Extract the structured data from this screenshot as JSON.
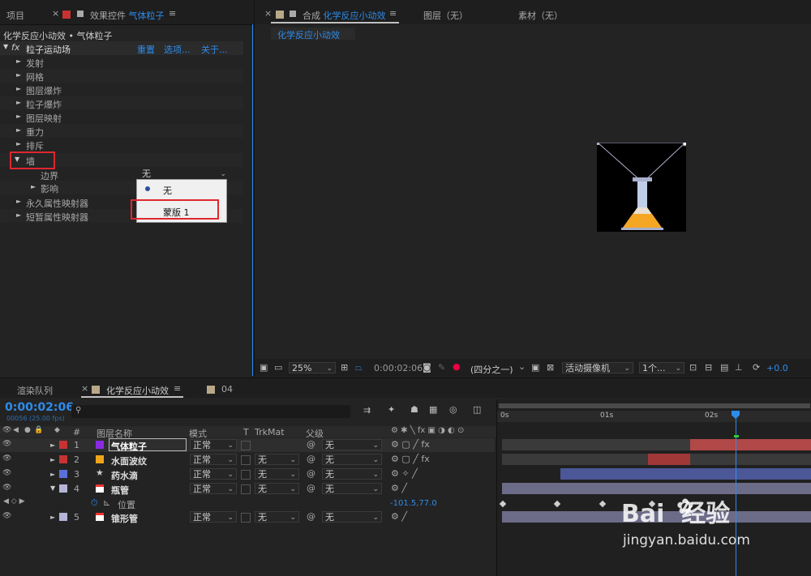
{
  "left_panel": {
    "tab_project": "项目",
    "tab_effects": "效果控件",
    "tab_effects_layer": "气体粒子",
    "breadcrumb": "化学反应小动效 • 气体粒子",
    "effect_name": "粒子运动场",
    "effect_reset": "重置",
    "effect_options": "选项...",
    "effect_about": "关于...",
    "props": [
      "发射",
      "网格",
      "图层爆炸",
      "粒子爆炸",
      "图层映射",
      "重力",
      "排斥"
    ],
    "wall_label": "墙",
    "boundary_label": "边界",
    "boundary_value": "无",
    "affect_label": "影响",
    "persistent_label": "永久属性映射器",
    "ephemeral_label": "短暂属性映射器",
    "dropdown_options": [
      "无",
      "蒙版 1"
    ]
  },
  "comp_panel": {
    "tab_comp_prefix": "合成",
    "tab_comp_name": "化学反应小动效",
    "tab_layer": "图层（无）",
    "tab_footage": "素材（无）",
    "sub_tab": "化学反应小动效",
    "zoom": "25%",
    "timecode": "0:00:02:06",
    "resolution": "(四分之一)",
    "camera": "活动摄像机",
    "views": "1个...",
    "exposure": "+0.0"
  },
  "timeline": {
    "tab_render": "渲染队列",
    "tab_comp": "化学反应小动效",
    "tab_04": "04",
    "timecode": "0:00:02:06",
    "frame_info": "00056 (25.00 fps)",
    "search_placeholder": "",
    "col_num": "#",
    "col_name": "图层名称",
    "col_mode": "模式",
    "col_t": "T",
    "col_trkmat": "TrkMat",
    "col_parent": "父级",
    "ruler": [
      "0s",
      "01s",
      "02s"
    ],
    "layers": [
      {
        "num": "1",
        "name": "气体粒子",
        "color": "#8a2be2",
        "mode": "正常",
        "trkmat": "",
        "parent": "无"
      },
      {
        "num": "2",
        "name": "水面波纹",
        "color": "#f0a41c",
        "mode": "正常",
        "trkmat": "无",
        "parent": "无"
      },
      {
        "num": "3",
        "name": "药水滴",
        "color": "#5b6fd8",
        "mode": "正常",
        "trkmat": "无",
        "parent": "无"
      },
      {
        "num": "4",
        "name": "瓶管",
        "color": "#b4b4d8",
        "mode": "正常",
        "trkmat": "无",
        "parent": "无"
      },
      {
        "num": "5",
        "name": "锥形管",
        "color": "#b4b4d8",
        "mode": "正常",
        "trkmat": "无",
        "parent": "无"
      }
    ],
    "position_label": "位置",
    "position_value": "-101.5,77.0"
  },
  "watermark": {
    "brand": "Bai  经验",
    "url": "jingyan.baidu.com"
  },
  "colors": {
    "accent": "#2d8ceb",
    "highlight_box": "#e0262e"
  }
}
